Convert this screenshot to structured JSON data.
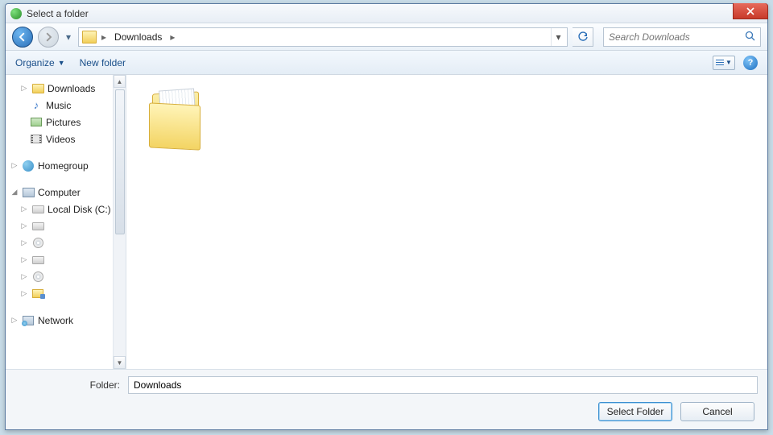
{
  "titlebar": {
    "title": "Select a folder"
  },
  "breadcrumb": {
    "current": "Downloads"
  },
  "search": {
    "placeholder": "Search Downloads"
  },
  "toolbar": {
    "organize": "Organize",
    "new_folder": "New folder"
  },
  "sidebar": {
    "downloads": "Downloads",
    "music": "Music",
    "pictures": "Pictures",
    "videos": "Videos",
    "homegroup": "Homegroup",
    "computer": "Computer",
    "local_disk": "Local Disk (C:)",
    "network": "Network"
  },
  "footer": {
    "folder_label": "Folder:",
    "folder_value": "Downloads",
    "select_btn": "Select Folder",
    "cancel_btn": "Cancel"
  }
}
